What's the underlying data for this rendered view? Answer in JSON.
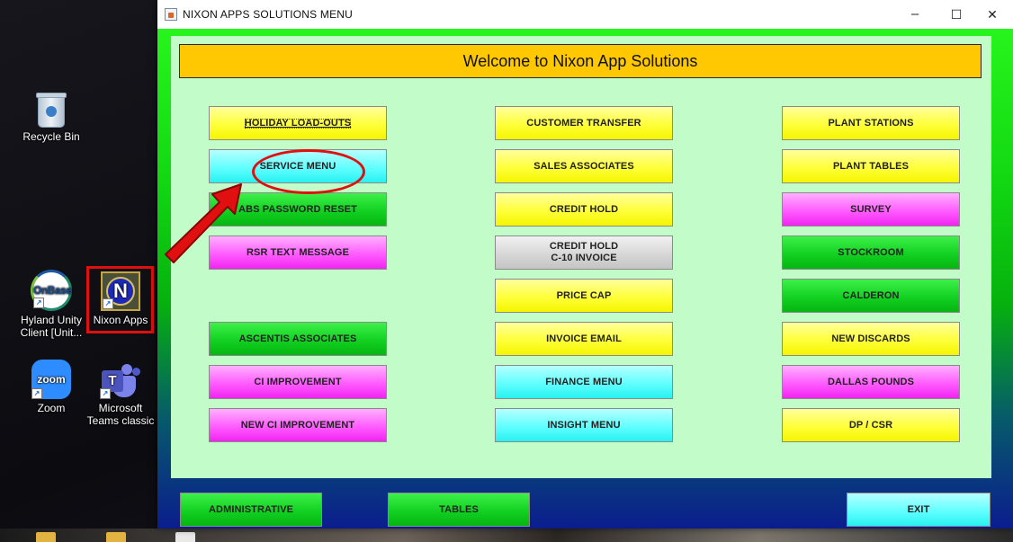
{
  "window": {
    "title": "NIXON APPS SOLUTIONS MENU",
    "controls": {
      "minimize": "–",
      "maximize": "☐",
      "close": "✕"
    }
  },
  "banner": "Welcome to Nixon App Solutions",
  "columns": {
    "left": [
      {
        "label": "HOLIDAY LOAD-OUTS",
        "color": "yellow"
      },
      {
        "label": "SERVICE MENU",
        "color": "cyan"
      },
      {
        "label": "ABS PASSWORD RESET",
        "color": "green"
      },
      {
        "label": "RSR TEXT MESSAGE",
        "color": "magenta"
      },
      {
        "label": "ASCENTIS ASSOCIATES",
        "color": "green"
      },
      {
        "label": "CI IMPROVEMENT",
        "color": "magenta"
      },
      {
        "label": "NEW CI IMPROVEMENT",
        "color": "magenta"
      }
    ],
    "middle": [
      {
        "label": "CUSTOMER TRANSFER",
        "color": "yellow"
      },
      {
        "label": "SALES ASSOCIATES",
        "color": "yellow"
      },
      {
        "label": "CREDIT HOLD",
        "color": "yellow"
      },
      {
        "label_line1": "CREDIT HOLD",
        "label_line2": "C-10 INVOICE",
        "color": "gray"
      },
      {
        "label": "PRICE CAP",
        "color": "yellow"
      },
      {
        "label": "INVOICE EMAIL",
        "color": "yellow"
      },
      {
        "label": "FINANCE MENU",
        "color": "cyan"
      },
      {
        "label": "INSIGHT MENU",
        "color": "cyan"
      }
    ],
    "right": [
      {
        "label": "PLANT STATIONS",
        "color": "yellow"
      },
      {
        "label": "PLANT TABLES",
        "color": "yellow"
      },
      {
        "label": "SURVEY",
        "color": "magenta"
      },
      {
        "label": "STOCKROOM",
        "color": "green"
      },
      {
        "label": "CALDERON",
        "color": "green"
      },
      {
        "label": "NEW DISCARDS",
        "color": "yellow"
      },
      {
        "label": "DALLAS POUNDS",
        "color": "magenta"
      },
      {
        "label": "DP / CSR",
        "color": "yellow"
      }
    ]
  },
  "footer": {
    "administrative": "ADMINISTRATIVE",
    "tables": "TABLES",
    "exit": "EXIT"
  },
  "desktop_icons": {
    "recycle_bin": "Recycle Bin",
    "onbase_label": "Hyland Unity Client [Unit...",
    "onbase_logo": "OnBase",
    "nixon_label": "Nixon Apps",
    "nixon_logo": "N",
    "zoom_label": "Zoom",
    "zoom_logo": "zoom",
    "teams_label": "Microsoft Teams classic",
    "teams_logo": "T"
  },
  "colors": {
    "banner": "#ffc800",
    "panel": "#c2fcc8",
    "yellow": "#ffff3a",
    "cyan": "#62ffff",
    "green": "#12d121",
    "magenta": "#ff5cff",
    "gray": "#d5d5d5",
    "annotation": "#e01010"
  }
}
